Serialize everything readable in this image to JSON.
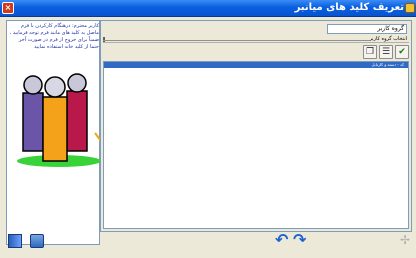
{
  "window": {
    "title": "تعریف کلید های میانبر",
    "sys_icon": "close-icon"
  },
  "help": {
    "text": "کاربر محترم: درهنگام کارکردن با فرم ماصل به کلید های مانند فرم توجه فرمایید ، ضمناً برای خروج از فرم در صورت آخر حتما از کلید خانه استفاده نمایید"
  },
  "form": {
    "group_field_value": "گروه کاربر",
    "group_select_label": "انتخاب گروه کاربر"
  },
  "toolbar": {
    "check_icon": "check-icon",
    "list_icon": "list-icon",
    "copy_icon": "copy-icon"
  },
  "list": {
    "rows": [
      "کد - دسته و کارتابل"
    ]
  },
  "bottom": {
    "icons": [
      "exit-door-icon",
      "exit-arrow-icon",
      "undo-icon",
      "redo-icon",
      "network-icon"
    ]
  },
  "colors": {
    "titlebar": "#0a5fe0",
    "selection": "#316ac5",
    "window_bg": "#ece9d8"
  }
}
